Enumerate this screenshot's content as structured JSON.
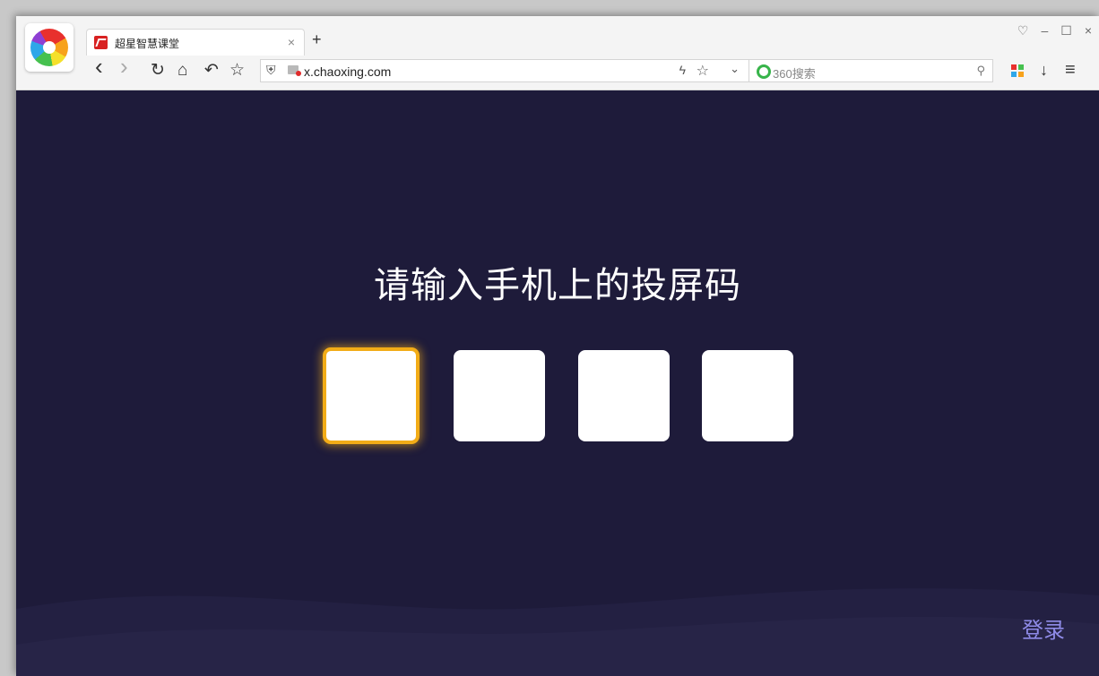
{
  "browser": {
    "tab": {
      "title": "超星智慧课堂",
      "close_glyph": "×"
    },
    "new_tab_glyph": "+",
    "window_controls": {
      "skin": "♡",
      "minimize": "–",
      "maximize": "☐",
      "close": "×"
    },
    "nav": {
      "back": "‹",
      "forward": "›",
      "reload": "↻",
      "home": "⌂",
      "undo": "↶",
      "favorite": "☆"
    },
    "address": {
      "url": "x.chaoxing.com",
      "shield_glyph": "⛨",
      "bolt_glyph": "ϟ",
      "star_glyph": "☆",
      "chevron_glyph": "⌄"
    },
    "search": {
      "placeholder": "360搜索",
      "icon": "⚲"
    },
    "ext_colors": [
      "#e8302d",
      "#46c14f",
      "#2ea7e9",
      "#f7a21b"
    ],
    "download_glyph": "↓",
    "menu_glyph": "≡"
  },
  "page": {
    "prompt": "请输入手机上的投屏码",
    "code_length": 4,
    "active_index": 0,
    "login_label": "登录"
  },
  "colors": {
    "background": "#1e1b3a",
    "active_border": "#f2ac17",
    "login_text": "#8f8be8"
  }
}
